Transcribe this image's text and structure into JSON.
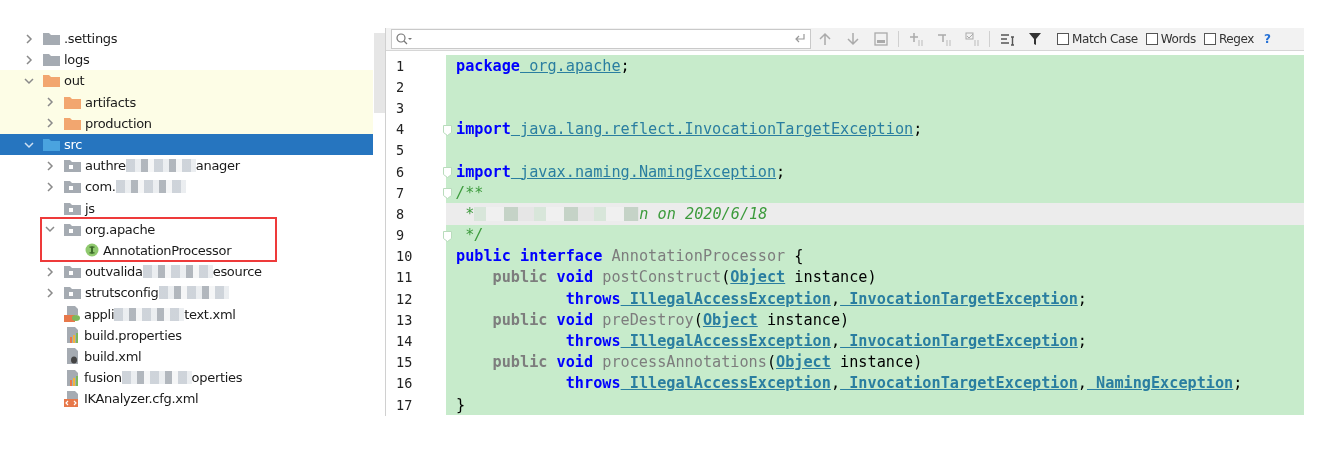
{
  "project_tree": {
    "items": [
      {
        "label": ".settings",
        "kind": "folder",
        "expanded": false,
        "selected": false,
        "redacted": false
      },
      {
        "label": "logs",
        "kind": "folder",
        "expanded": false,
        "selected": false,
        "redacted": false
      },
      {
        "label": "out",
        "kind": "excluded-folder",
        "expanded": true,
        "selected": false,
        "redacted": false,
        "children": [
          {
            "label": "artifacts",
            "kind": "excluded-folder",
            "expanded": false,
            "selected": false,
            "redacted": false
          },
          {
            "label": "production",
            "kind": "excluded-folder",
            "expanded": false,
            "selected": false,
            "redacted": false
          }
        ]
      },
      {
        "label": "src",
        "kind": "source-folder",
        "expanded": true,
        "selected": true,
        "redacted": false,
        "children": [
          {
            "label": "authre",
            "label_tail": "anager",
            "kind": "package",
            "expanded": false,
            "selected": false,
            "redacted": true
          },
          {
            "label": "com.",
            "kind": "package",
            "expanded": false,
            "selected": false,
            "redacted": true
          },
          {
            "label": "js",
            "kind": "package",
            "selected": false,
            "redacted": false
          },
          {
            "label": "org.apache",
            "kind": "package",
            "expanded": true,
            "selected": false,
            "redacted": false,
            "highlighted": true,
            "children": [
              {
                "label": "AnnotationProcessor",
                "kind": "interface",
                "selected": false,
                "redacted": false
              }
            ]
          },
          {
            "label": "outvalida",
            "label_tail": "esource",
            "kind": "package",
            "expanded": false,
            "selected": false,
            "redacted": true
          },
          {
            "label": "strutsconfig",
            "kind": "package",
            "expanded": false,
            "selected": false,
            "redacted": true
          },
          {
            "label": "appli",
            "label_tail": "text.xml",
            "kind": "spring-xml",
            "selected": false,
            "redacted": true
          },
          {
            "label": "build.properties",
            "kind": "properties",
            "selected": false,
            "redacted": false
          },
          {
            "label": "build.xml",
            "kind": "ant-xml",
            "selected": false,
            "redacted": false
          },
          {
            "label": "fusion",
            "label_tail": "operties",
            "kind": "properties",
            "selected": false,
            "redacted": true
          },
          {
            "label": "IKAnalyzer.cfg.xml",
            "kind": "xml",
            "selected": false,
            "redacted": false
          }
        ]
      }
    ]
  },
  "search_bar": {
    "options": [
      {
        "label": "Match Case",
        "checked": false
      },
      {
        "label": "Words",
        "checked": false
      },
      {
        "label": "Regex",
        "checked": false
      }
    ],
    "help": "?"
  },
  "editor": {
    "lines": [
      {
        "number": "1",
        "fold": false,
        "current": false,
        "tokens": [
          {
            "t": "package",
            "kind": "kw"
          },
          {
            "t": " org.apache",
            "kind": "ref"
          },
          {
            "t": ";",
            "kind": "plain"
          }
        ]
      },
      {
        "number": "2",
        "fold": false,
        "current": false
      },
      {
        "number": "3",
        "fold": false,
        "current": false
      },
      {
        "number": "4",
        "fold": true,
        "current": false,
        "tokens": [
          {
            "t": "import",
            "kind": "kw"
          },
          {
            "t": " java.lang.reflect.InvocationTargetException",
            "kind": "ref"
          },
          {
            "t": ";",
            "kind": "plain"
          }
        ]
      },
      {
        "number": "5",
        "fold": false,
        "current": false
      },
      {
        "number": "6",
        "fold": true,
        "current": false,
        "tokens": [
          {
            "t": "import",
            "kind": "kw"
          },
          {
            "t": " javax.naming.NamingException",
            "kind": "ref"
          },
          {
            "t": ";",
            "kind": "plain"
          }
        ]
      },
      {
        "number": "7",
        "fold": true,
        "current": false,
        "tokens": [
          {
            "t": "/**",
            "kind": "comment"
          }
        ]
      },
      {
        "number": "8",
        "fold": false,
        "current": true,
        "tokens": [
          {
            "t": " *",
            "kind": "comment"
          },
          {
            "kind": "redacted"
          },
          {
            "t": "n on 2020/6/18",
            "kind": "comment"
          }
        ]
      },
      {
        "number": "9",
        "fold": true,
        "current": false,
        "tokens": [
          {
            "t": " */",
            "kind": "comment"
          }
        ]
      },
      {
        "number": "10",
        "fold": false,
        "current": false,
        "tokens": [
          {
            "t": "public interface",
            "kind": "kw"
          },
          {
            "t": " AnnotationProcessor",
            "kind": "unused"
          },
          {
            "t": " {",
            "kind": "plain"
          }
        ]
      },
      {
        "number": "11",
        "fold": false,
        "current": false,
        "tokens": [
          {
            "t": "    public",
            "kind": "unused-kw"
          },
          {
            "t": " void",
            "kind": "kw"
          },
          {
            "t": " postConstruct",
            "kind": "unused"
          },
          {
            "t": "(",
            "kind": "plain"
          },
          {
            "t": "Object",
            "kind": "type-ref"
          },
          {
            "t": " instance)",
            "kind": "plain"
          }
        ]
      },
      {
        "number": "12",
        "fold": false,
        "current": false,
        "tokens": [
          {
            "t": "            throws",
            "kind": "kw"
          },
          {
            "t": " IllegalAccessException",
            "kind": "type-ref"
          },
          {
            "t": ",",
            "kind": "plain"
          },
          {
            "t": " InvocationTargetException",
            "kind": "type-ref"
          },
          {
            "t": ";",
            "kind": "plain"
          }
        ]
      },
      {
        "number": "13",
        "fold": false,
        "current": false,
        "tokens": [
          {
            "t": "    public",
            "kind": "unused-kw"
          },
          {
            "t": " void",
            "kind": "kw"
          },
          {
            "t": " preDestroy",
            "kind": "unused"
          },
          {
            "t": "(",
            "kind": "plain"
          },
          {
            "t": "Object",
            "kind": "type-ref"
          },
          {
            "t": " instance)",
            "kind": "plain"
          }
        ]
      },
      {
        "number": "14",
        "fold": false,
        "current": false,
        "tokens": [
          {
            "t": "            throws",
            "kind": "kw"
          },
          {
            "t": " IllegalAccessException",
            "kind": "type-ref"
          },
          {
            "t": ",",
            "kind": "plain"
          },
          {
            "t": " InvocationTargetException",
            "kind": "type-ref"
          },
          {
            "t": ";",
            "kind": "plain"
          }
        ]
      },
      {
        "number": "15",
        "fold": false,
        "current": false,
        "tokens": [
          {
            "t": "    public",
            "kind": "unused-kw"
          },
          {
            "t": " void",
            "kind": "kw"
          },
          {
            "t": " processAnnotations",
            "kind": "unused"
          },
          {
            "t": "(",
            "kind": "plain"
          },
          {
            "t": "Object",
            "kind": "type-ref"
          },
          {
            "t": " instance)",
            "kind": "plain"
          }
        ]
      },
      {
        "number": "16",
        "fold": false,
        "current": false,
        "tokens": [
          {
            "t": "            throws",
            "kind": "kw"
          },
          {
            "t": " IllegalAccessException",
            "kind": "type-ref"
          },
          {
            "t": ",",
            "kind": "plain"
          },
          {
            "t": " InvocationTargetException",
            "kind": "type-ref"
          },
          {
            "t": ",",
            "kind": "plain"
          },
          {
            "t": " NamingException",
            "kind": "type-ref"
          },
          {
            "t": ";",
            "kind": "plain"
          }
        ]
      },
      {
        "number": "17",
        "fold": false,
        "current": false,
        "tokens": [
          {
            "t": "}",
            "kind": "plain"
          }
        ]
      }
    ]
  }
}
